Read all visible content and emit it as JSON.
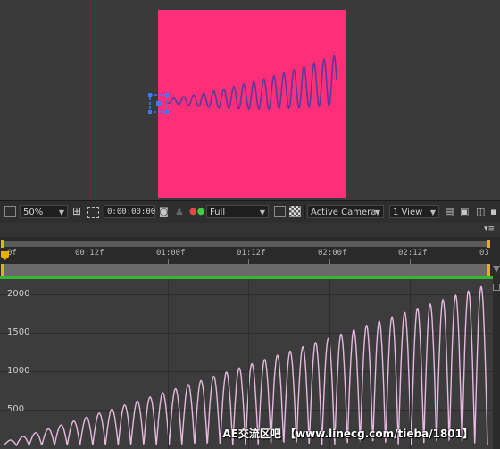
{
  "viewer": {
    "comp_color": "#ff2e79",
    "wave_color": "#5b3a9e",
    "handle_color": "#3a7bff"
  },
  "toolbar": {
    "zoom": "50%",
    "timecode": "0:00:00:00",
    "resolution": "Full",
    "camera": "Active Camera",
    "views": "1 View",
    "icons": [
      "comp-viewer-icon",
      "zoom-dropdown-icon",
      "grid-icon",
      "region-of-interest-icon",
      "snapshot-icon",
      "show-snapshot-icon",
      "color-channel-icon",
      "resolution-dropdown-icon",
      "fast-preview-icon",
      "transparency-grid-icon",
      "camera-dropdown-icon",
      "view-layout-dropdown-icon",
      "toggle-pixel-aspect-icon",
      "comp-flowchart-icon",
      "3d-view-icon"
    ]
  },
  "timeline": {
    "panel_menu": "▾≡",
    "ruler_labels": [
      "0f",
      "00:12f",
      "01:00f",
      "01:12f",
      "02:00f",
      "02:12f",
      "03"
    ],
    "graph_y_labels": [
      "2000",
      "1500",
      "1000",
      "500"
    ],
    "curve_color": "#e7b9e0",
    "accent_green": "#35b635",
    "cti_color": "#e8b100"
  },
  "watermark": "AE交流区吧 【www.linecg.com/tieba/1801】"
}
